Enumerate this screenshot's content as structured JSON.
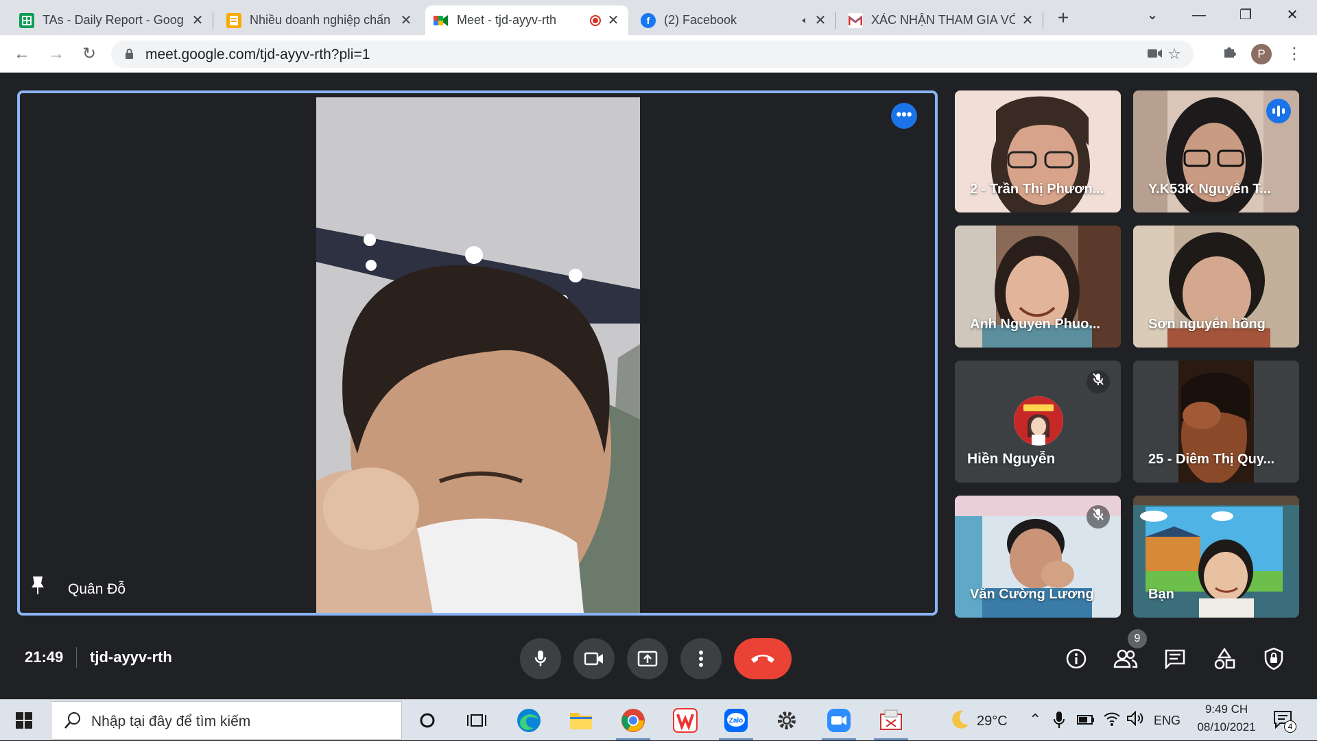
{
  "browser": {
    "tabs": [
      {
        "title": "TAs - Daily Report - Goog",
        "favicon": "sheets-icon",
        "active": false
      },
      {
        "title": "Nhiều doanh nghiệp chấn",
        "favicon": "document-icon",
        "active": false
      },
      {
        "title": "Meet - tjd-ayyv-rth",
        "favicon": "meet-icon",
        "active": true,
        "recording": true
      },
      {
        "title": "(2) Facebook",
        "favicon": "facebook-icon",
        "active": false,
        "audio": true
      },
      {
        "title": "XÁC NHẬN THAM GIA VỚ",
        "favicon": "gmail-icon",
        "active": false
      }
    ],
    "url": "meet.google.com/tjd-ayyv-rth?pli=1",
    "profile_initial": "P"
  },
  "meet": {
    "main_speaker": {
      "name": "Quân Đỗ",
      "pinned": true
    },
    "participants": [
      {
        "name": "2 - Trần Thị Phươn...",
        "muted": false,
        "speaking": false
      },
      {
        "name": "Y.K53K Nguyễn T...",
        "muted": false,
        "speaking": true
      },
      {
        "name": "Anh Nguyen Phuo...",
        "muted": false,
        "speaking": false
      },
      {
        "name": "Sơn nguyễn hồng",
        "muted": false,
        "speaking": false
      },
      {
        "name": "Hiền Nguyễn",
        "muted": true,
        "speaking": false,
        "avatar_text": "VUPCOMIC"
      },
      {
        "name": "25 - Diêm Thị Quy...",
        "muted": false,
        "speaking": false
      },
      {
        "name": "Văn Cường Lương",
        "muted": true,
        "speaking": false
      },
      {
        "name": "Bạn",
        "muted": false,
        "speaking": false
      }
    ],
    "clock": "21:49",
    "meeting_code": "tjd-ayyv-rth",
    "people_count": "9",
    "colors": {
      "accent": "#1a73e8",
      "hangup": "#ea4335",
      "pin_border": "#8ab4f8",
      "background": "#202124"
    }
  },
  "taskbar": {
    "search_placeholder": "Nhập tại đây để tìm kiếm",
    "weather": "29°C",
    "language": "ENG",
    "time": "9:49 CH",
    "date": "08/10/2021",
    "notifications": "4"
  }
}
